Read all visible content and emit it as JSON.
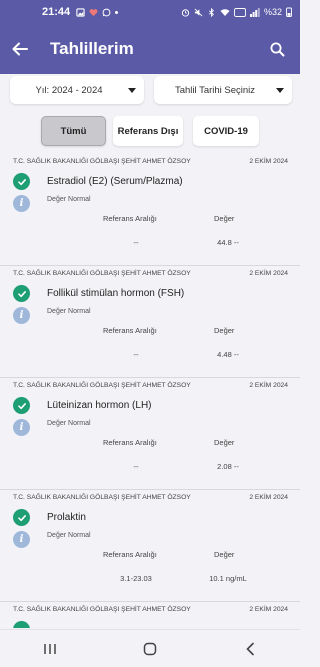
{
  "status_bar": {
    "time": "21:44",
    "battery": "%32"
  },
  "appbar": {
    "title": "Tahlillerim"
  },
  "filters": {
    "year": "Yıl: 2024 - 2024",
    "date": "Tahlil Tarihi Seçiniz"
  },
  "tabs": {
    "all": "Tümü",
    "ref_out": "Referans Dışı",
    "covid": "COVID-19"
  },
  "columns": {
    "ref": "Referans Aralığı",
    "value": "Değer"
  },
  "results": [
    {
      "hospital": "T.C. SAĞLIK BAKANLIĞI GÖLBAŞI ŞEHİT AHMET ÖZSOY",
      "date": "2 EKİM 2024",
      "name": "Estradiol (E2) (Serum/Plazma)",
      "status": "Değer Normal",
      "ref": "--",
      "value": "44.8 --"
    },
    {
      "hospital": "T.C. SAĞLIK BAKANLIĞI GÖLBAŞI ŞEHİT AHMET ÖZSOY",
      "date": "2 EKİM 2024",
      "name": "Follikül stimülan hormon (FSH)",
      "status": "Değer Normal",
      "ref": "--",
      "value": "4.48 --"
    },
    {
      "hospital": "T.C. SAĞLIK BAKANLIĞI GÖLBAŞI ŞEHİT AHMET ÖZSOY",
      "date": "2 EKİM 2024",
      "name": "Lüteinizan hormon (LH)",
      "status": "Değer Normal",
      "ref": "--",
      "value": "2.08 --"
    },
    {
      "hospital": "T.C. SAĞLIK BAKANLIĞI GÖLBAŞI ŞEHİT AHMET ÖZSOY",
      "date": "2 EKİM 2024",
      "name": "Prolaktin",
      "status": "Değer Normal",
      "ref": "3.1-23.03",
      "value": "10.1 ng/mL"
    }
  ],
  "partial_result": {
    "hospital": "T.C. SAĞLIK BAKANLIĞI GÖLBAŞI ŞEHİT AHMET ÖZSOY",
    "date": "2 EKİM 2024"
  },
  "colors": {
    "primary": "#5b5aa6",
    "success": "#1e9e73",
    "info": "#9fb8da"
  }
}
